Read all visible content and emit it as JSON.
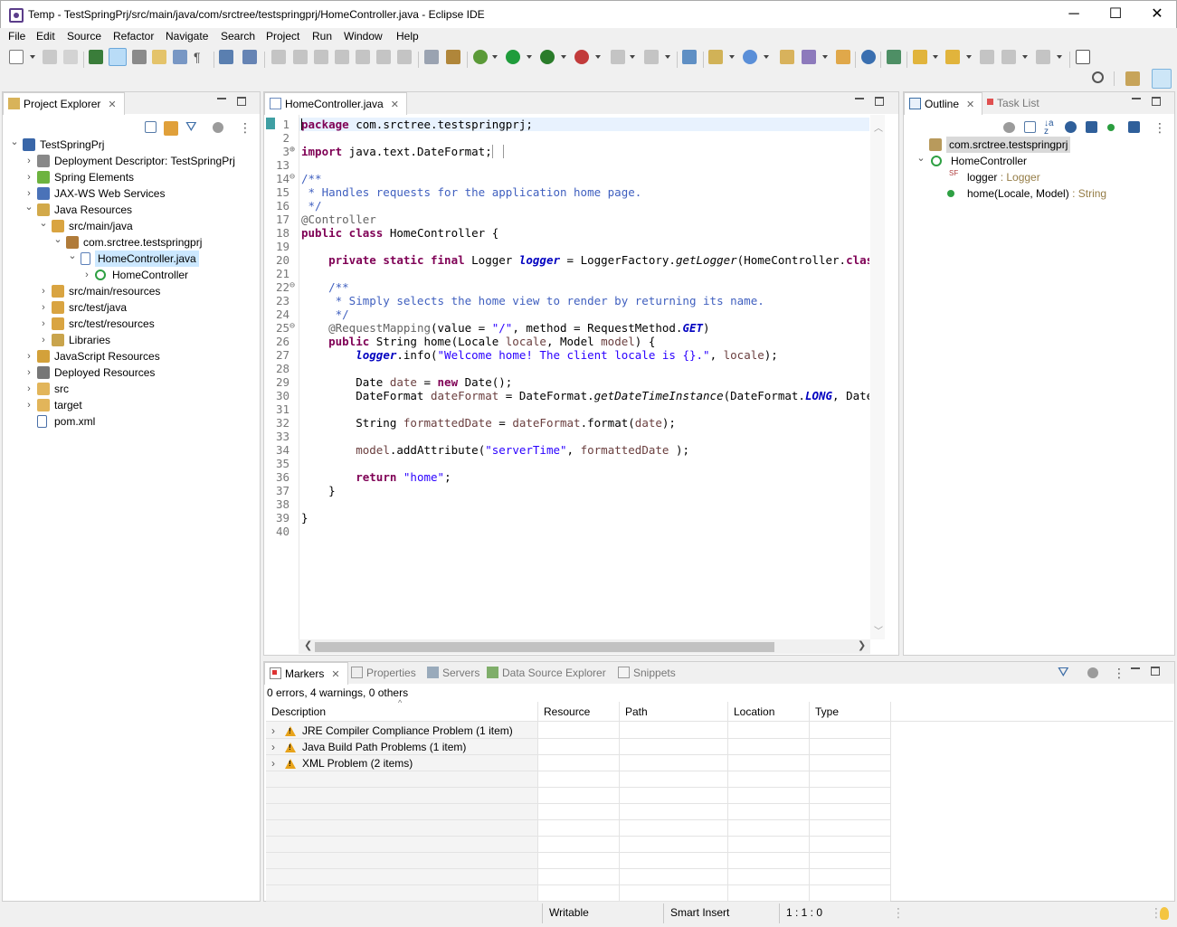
{
  "window": {
    "title": "Temp - TestSpringPrj/src/main/java/com/srctree/testspringprj/HomeController.java - Eclipse IDE",
    "minimize": "─",
    "maximize": "☐",
    "close": "✕"
  },
  "menu": [
    "File",
    "Edit",
    "Source",
    "Refactor",
    "Navigate",
    "Search",
    "Project",
    "Run",
    "Window",
    "Help"
  ],
  "project_explorer": {
    "tab_label": "Project Explorer",
    "tree": [
      {
        "label": "TestSpringPrj",
        "icon": "maven-project-icon",
        "expanded": true
      },
      {
        "label": "Deployment Descriptor: TestSpringPrj",
        "icon": "deployment-descriptor-icon"
      },
      {
        "label": "Spring Elements",
        "icon": "spring-leaf-icon"
      },
      {
        "label": "JAX-WS Web Services",
        "icon": "web-services-icon"
      },
      {
        "label": "Java Resources",
        "icon": "java-resources-icon",
        "expanded": true
      },
      {
        "label": "src/main/java",
        "icon": "source-folder-icon",
        "expanded": true
      },
      {
        "label": "com.srctree.testspringprj",
        "icon": "package-icon",
        "expanded": true
      },
      {
        "label": "HomeController.java",
        "icon": "java-file-icon",
        "expanded": true,
        "selected": true
      },
      {
        "label": "HomeController",
        "icon": "class-icon"
      },
      {
        "label": "src/main/resources",
        "icon": "source-folder-icon"
      },
      {
        "label": "src/test/java",
        "icon": "source-folder-icon"
      },
      {
        "label": "src/test/resources",
        "icon": "source-folder-icon"
      },
      {
        "label": "Libraries",
        "icon": "libraries-icon"
      },
      {
        "label": "JavaScript Resources",
        "icon": "javascript-resources-icon"
      },
      {
        "label": "Deployed Resources",
        "icon": "deployed-resources-icon"
      },
      {
        "label": "src",
        "icon": "folder-icon"
      },
      {
        "label": "target",
        "icon": "folder-icon"
      },
      {
        "label": "pom.xml",
        "icon": "pom-file-icon"
      }
    ]
  },
  "editor": {
    "tab_label": "HomeController.java",
    "lines": [
      {
        "n": "1",
        "html": "<span class='kw'>package</span> com.srctree.testspringprj;"
      },
      {
        "n": "2",
        "html": ""
      },
      {
        "n": "3",
        "html": "<span class='kw'>import</span> java.text.DateFormat;<span style='border:1px solid #999;padding:0 2px;'> </span>",
        "fold": "⊕"
      },
      {
        "n": "13",
        "html": ""
      },
      {
        "n": "14",
        "html": "<span class='cmt'>/**</span>",
        "fold": "⊖"
      },
      {
        "n": "15",
        "html": "<span class='cmt'> * Handles requests for the application home page.</span>"
      },
      {
        "n": "16",
        "html": "<span class='cmt'> */</span>"
      },
      {
        "n": "17",
        "html": "<span class='ann'>@Controller</span>"
      },
      {
        "n": "18",
        "html": "<span class='kw'>public class</span> HomeController {"
      },
      {
        "n": "19",
        "html": ""
      },
      {
        "n": "20",
        "html": "    <span class='kw'>private static final</span> Logger <span class='sfld'>logger</span> = LoggerFactory.<span class='stat'>getLogger</span>(HomeController.<span class='kw'>class</span>);"
      },
      {
        "n": "21",
        "html": ""
      },
      {
        "n": "22",
        "html": "    <span class='cmt'>/**</span>",
        "fold": "⊖"
      },
      {
        "n": "23",
        "html": "<span class='cmt'>     * Simply selects the home view to render by returning its name.</span>"
      },
      {
        "n": "24",
        "html": "<span class='cmt'>     */</span>"
      },
      {
        "n": "25",
        "html": "    <span class='ann'>@RequestMapping</span>(value = <span class='str'>\"/\"</span>, method = RequestMethod.<span class='sfld'>GET</span>)",
        "fold": "⊖"
      },
      {
        "n": "26",
        "html": "    <span class='kw'>public</span> String home(Locale <span class='param'>locale</span>, Model <span class='param'>model</span>) {"
      },
      {
        "n": "27",
        "html": "        <span class='sfld'>logger</span>.info(<span class='str'>\"Welcome home! The client locale is {}.\"</span>, <span class='param'>locale</span>);"
      },
      {
        "n": "28",
        "html": ""
      },
      {
        "n": "29",
        "html": "        Date <span class='param'>date</span> = <span class='kw'>new</span> Date();"
      },
      {
        "n": "30",
        "html": "        DateFormat <span class='param'>dateFormat</span> = DateFormat.<span class='stat'>getDateTimeInstance</span>(DateFormat.<span class='sfld'>LONG</span>, DateFormat"
      },
      {
        "n": "31",
        "html": ""
      },
      {
        "n": "32",
        "html": "        String <span class='param'>formattedDate</span> = <span class='param'>dateFormat</span>.format(<span class='param'>date</span>);"
      },
      {
        "n": "33",
        "html": ""
      },
      {
        "n": "34",
        "html": "        <span class='param'>model</span>.addAttribute(<span class='str'>\"serverTime\"</span>, <span class='param'>formattedDate</span> );"
      },
      {
        "n": "35",
        "html": ""
      },
      {
        "n": "36",
        "html": "        <span class='kw'>return</span> <span class='str'>\"home\"</span>;"
      },
      {
        "n": "37",
        "html": "    }"
      },
      {
        "n": "38",
        "html": ""
      },
      {
        "n": "39",
        "html": "}"
      },
      {
        "n": "40",
        "html": ""
      }
    ]
  },
  "outline": {
    "tab_label": "Outline",
    "tab2_label": "Task List",
    "items": [
      {
        "label": "com.srctree.testspringprj",
        "icon": "package-decl-icon",
        "selected": true
      },
      {
        "label": "HomeController",
        "icon": "class-icon",
        "expanded": true
      },
      {
        "label": "logger",
        "type": " : Logger",
        "icon": "static-final-field-icon",
        "sup": "SF"
      },
      {
        "label": "home(Locale, Model)",
        "type": " : String",
        "icon": "public-method-icon"
      }
    ]
  },
  "bottom": {
    "tabs": [
      "Markers",
      "Properties",
      "Servers",
      "Data Source Explorer",
      "Snippets"
    ],
    "summary": "0 errors, 4 warnings, 0 others",
    "columns": [
      "Description",
      "Resource",
      "Path",
      "Location",
      "Type"
    ],
    "rows": [
      {
        "description": "JRE Compiler Compliance Problem (1 item)"
      },
      {
        "description": "Java Build Path Problems (1 item)"
      },
      {
        "description": "XML Problem (2 items)"
      }
    ]
  },
  "status": {
    "writable": "Writable",
    "insert_mode": "Smart Insert",
    "position": "1 : 1 : 0"
  },
  "colors": {
    "keyword": "#7f0055",
    "string": "#2a00ff",
    "comment": "#3f5fbf",
    "field": "#0000c0",
    "selection": "#cce8ff",
    "current_line": "#e8f2fe"
  }
}
